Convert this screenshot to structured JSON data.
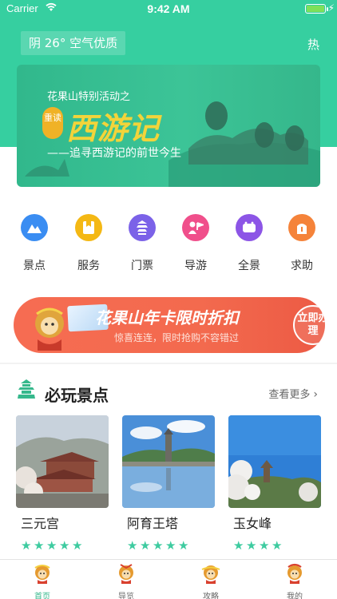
{
  "status_bar": {
    "carrier": "Carrier",
    "time": "9:42 AM"
  },
  "header": {
    "weather": "阴 26° 空气优质",
    "hot_label": "热"
  },
  "banner": {
    "subtitle": "花果山特别活动之",
    "reread": "重读",
    "title": "西游记",
    "tagline": "——追寻西游记的前世今生"
  },
  "menu": {
    "items": [
      {
        "label": "景点",
        "icon": "mountain-icon",
        "color": "#3a8df2"
      },
      {
        "label": "服务",
        "icon": "service-icon",
        "color": "#f4b814"
      },
      {
        "label": "门票",
        "icon": "pagoda-icon",
        "color": "#7b62e8"
      },
      {
        "label": "导游",
        "icon": "guide-icon",
        "color": "#f04f8b"
      },
      {
        "label": "全景",
        "icon": "panorama-icon",
        "color": "#8c55e6"
      },
      {
        "label": "求助",
        "icon": "help-icon",
        "color": "#f5833a"
      }
    ]
  },
  "promo": {
    "title": "花果山年卡限时折扣",
    "subtitle": "惊喜连连，限时抢购不容错过",
    "button": "立即办理"
  },
  "section": {
    "title": "必玩景点",
    "more": "查看更多",
    "spots": [
      {
        "name": "三元宫",
        "stars": 5
      },
      {
        "name": "阿育王塔",
        "stars": 5
      },
      {
        "name": "玉女峰",
        "stars": 4
      }
    ]
  },
  "tabbar": {
    "tabs": [
      {
        "label": "首页",
        "active": true
      },
      {
        "label": "导览",
        "active": false
      },
      {
        "label": "攻略",
        "active": false
      },
      {
        "label": "我的",
        "active": false
      }
    ]
  },
  "colors": {
    "primary": "#36cfa0",
    "accent_text": "#36b88c",
    "promo": "#f36a4e",
    "star": "#3ecba0"
  }
}
